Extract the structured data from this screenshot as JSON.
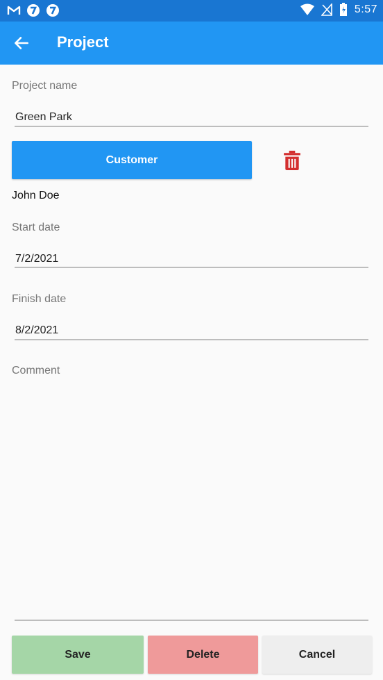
{
  "status_bar": {
    "time": "5:57",
    "left_icons": [
      "gmail-icon",
      "notification-icon",
      "notification-icon"
    ],
    "right_icons": [
      "wifi-icon",
      "no-signal-icon",
      "battery-icon"
    ]
  },
  "app_bar": {
    "title": "Project",
    "back_icon": "arrow-left-icon",
    "color": "#2196f3"
  },
  "form": {
    "project_name": {
      "label": "Project name",
      "value": "Green Park"
    },
    "customer": {
      "button_label": "Customer",
      "selected": "John Doe",
      "remove_icon": "trash-icon"
    },
    "start_date": {
      "label": "Start date",
      "value": "7/2/2021"
    },
    "finish_date": {
      "label": "Finish date",
      "value": "8/2/2021"
    },
    "comment": {
      "label": "Comment",
      "value": ""
    }
  },
  "actions": {
    "save": {
      "label": "Save",
      "color": "#a5d6a7"
    },
    "delete": {
      "label": "Delete",
      "color": "#ef9a9a"
    },
    "cancel": {
      "label": "Cancel",
      "color": "#eeeeee"
    }
  }
}
